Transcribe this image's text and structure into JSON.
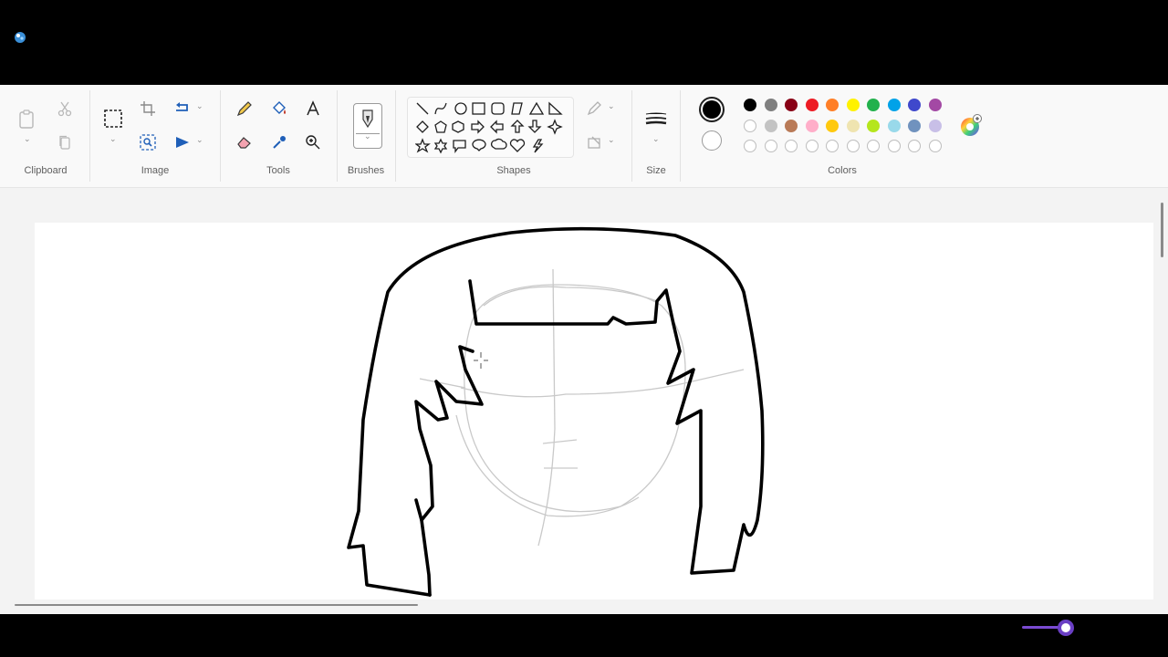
{
  "app": {
    "icon": "paint-app-icon"
  },
  "ribbon": {
    "groups": {
      "clipboard": "Clipboard",
      "image": "Image",
      "tools": "Tools",
      "brushes": "Brushes",
      "shapes": "Shapes",
      "size": "Size",
      "colors": "Colors"
    },
    "clipboard_tools": [
      "paste-icon",
      "cut-icon",
      "copy-icon"
    ],
    "image_tools": [
      "select-icon",
      "crop-icon",
      "resize-icon",
      "rotate-icon",
      "image-search-icon",
      "flip-icon"
    ],
    "drawing_tools": [
      "pencil-icon",
      "fill-icon",
      "text-icon",
      "eraser-icon",
      "color-picker-icon",
      "magnifier-icon"
    ],
    "shapes": [
      "line",
      "curve",
      "oval",
      "rectangle",
      "rounded-rectangle",
      "polygon",
      "triangle",
      "right-triangle",
      "diamond",
      "pentagon",
      "hexagon",
      "right-arrow",
      "left-arrow",
      "up-arrow",
      "down-arrow",
      "four-point-star",
      "five-point-star",
      "six-point-star",
      "rounded-callout",
      "oval-callout",
      "cloud-callout",
      "heart",
      "lightning"
    ],
    "colors": {
      "primary": "#000000",
      "secondary": "#ffffff",
      "row1": [
        "#000000",
        "#7f7f7f",
        "#880015",
        "#ed1c24",
        "#ff7f27",
        "#fff200",
        "#22b14c",
        "#00a2e8",
        "#3f48cc",
        "#a349a4"
      ],
      "row2": [
        "#ffffff",
        "#c3c3c3",
        "#b97a57",
        "#ffaec9",
        "#ffc90e",
        "#efe4b0",
        "#b5e61d",
        "#99d9ea",
        "#7092be",
        "#c8bfe7"
      ],
      "row3_empty": 10,
      "accent": "#6a3fc4"
    }
  },
  "status": {
    "zoom_fraction": 0.8
  }
}
